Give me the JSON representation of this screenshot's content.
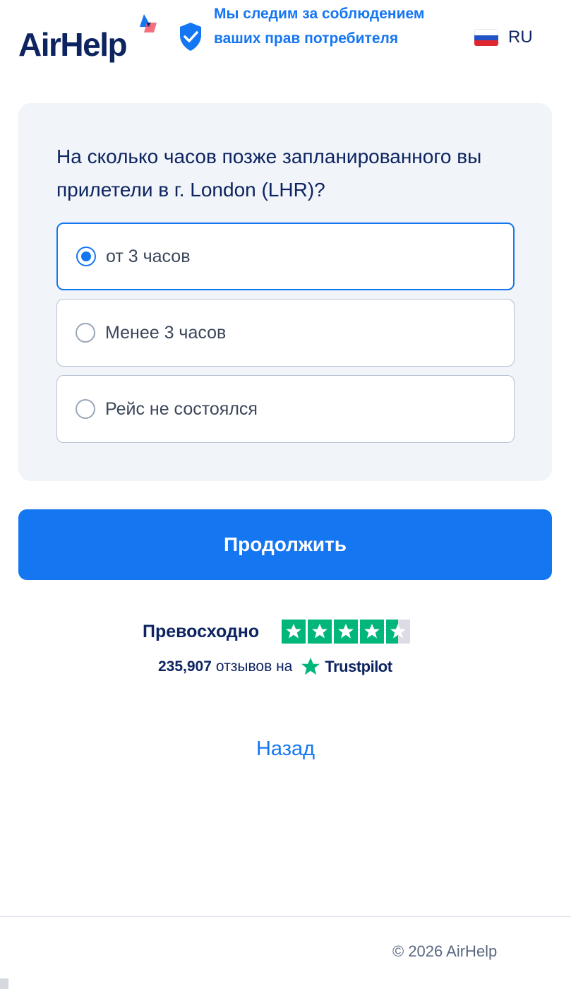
{
  "header": {
    "logo_text": "AirHelp",
    "consumer_rights_text": "Мы следим за соблюдением ваших прав потребителя",
    "language": "RU"
  },
  "question": {
    "text": "На сколько часов позже запланированного вы прилетели в г. London (LHR)?",
    "options": [
      {
        "label": "от 3 часов",
        "selected": true
      },
      {
        "label": "Менее 3 часов",
        "selected": false
      },
      {
        "label": "Рейс не состоялся",
        "selected": false
      }
    ]
  },
  "continue_label": "Продолжить",
  "rating": {
    "word": "Превосходно",
    "stars": 4.5,
    "reviews_count": "235,907",
    "reviews_text": "отзывов на",
    "platform": "Trustpilot"
  },
  "back_label": "Назад",
  "footer": {
    "copyright": "© 2026 AirHelp"
  },
  "colors": {
    "primary": "#1576f2",
    "navy": "#0d2461",
    "trustpilot_green": "#00b67a",
    "card_bg": "#f1f4f8"
  }
}
